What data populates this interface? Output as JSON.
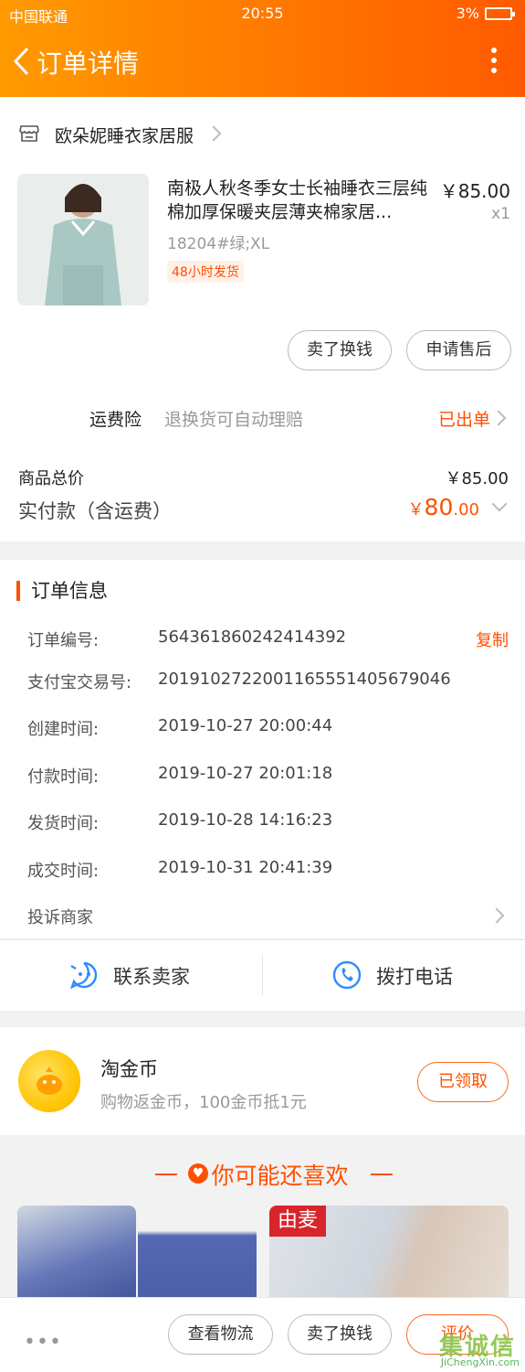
{
  "status_bar": {
    "carrier": "中国联通",
    "time": "20:55",
    "battery": "3%"
  },
  "header": {
    "title": "订单详情"
  },
  "shop": {
    "name": "欧朵妮睡衣家居服"
  },
  "product": {
    "title": "南极人秋冬季女士长袖睡衣三层纯棉加厚保暖夹层薄夹棉家居...",
    "price": "￥85.00",
    "qty": "x1",
    "sku": "18204#绿;XL",
    "tag": "48小时发货"
  },
  "product_actions": {
    "sell_label": "卖了换钱",
    "aftersale_label": "申请售后"
  },
  "insurance": {
    "label": "运费险",
    "desc": "退换货可自动理赔",
    "status": "已出单"
  },
  "totals": {
    "goods_label": "商品总价",
    "goods_value": "￥85.00",
    "paid_label": "实付款（含运费）",
    "paid_currency": "￥",
    "paid_int": "80",
    "paid_dec": ".00"
  },
  "order_info": {
    "title": "订单信息",
    "copy_label": "复制",
    "rows": [
      {
        "key": "订单编号:",
        "value": "564361860242414392"
      },
      {
        "key": "支付宝交易号:",
        "value": "2019102722001165551405679046"
      },
      {
        "key": "创建时间:",
        "value": "2019-10-27 20:00:44"
      },
      {
        "key": "付款时间:",
        "value": "2019-10-27 20:01:18"
      },
      {
        "key": "发货时间:",
        "value": "2019-10-28 14:16:23"
      },
      {
        "key": "成交时间:",
        "value": "2019-10-31 20:41:39"
      }
    ],
    "complain_label": "投诉商家"
  },
  "contact": {
    "seller_label": "联系卖家",
    "call_label": "拨打电话"
  },
  "coin": {
    "title": "淘金币",
    "desc": "购物返金币，100金币抵1元",
    "button_label": "已领取"
  },
  "recommend": {
    "title": "你可能还喜欢",
    "img_text": "由麦"
  },
  "bottom_bar": {
    "more": "•••",
    "logistics_label": "查看物流",
    "sell_label": "卖了换钱",
    "review_label": "评价"
  },
  "watermark": {
    "cn": "集诚信",
    "en": "JiChengXin.com"
  },
  "colors": {
    "accent": "#ff5000",
    "header_start": "#ff9a00",
    "header_end": "#ff5a00"
  }
}
